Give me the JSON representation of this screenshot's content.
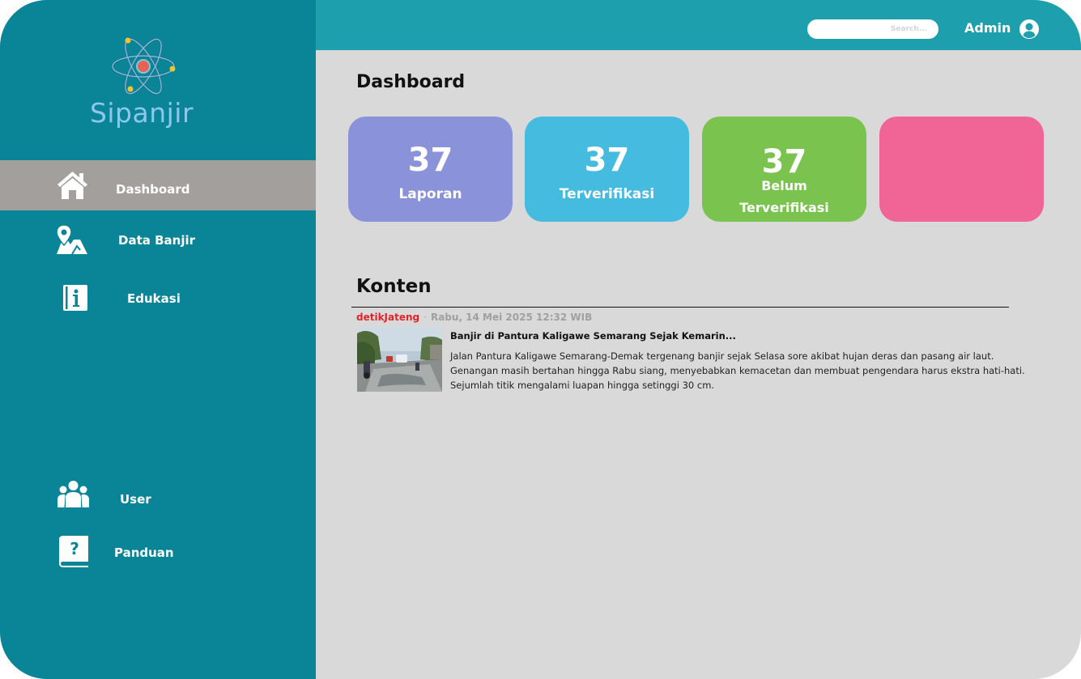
{
  "app": {
    "name": "Sipanjir"
  },
  "header": {
    "search_placeholder": "Search...",
    "user_label": "Admin",
    "user_icon": "user-circle-icon"
  },
  "sidebar": {
    "items": [
      {
        "label": "Dashboard",
        "icon": "home-icon",
        "active": true
      },
      {
        "label": "Data Banjir",
        "icon": "map-pin-icon",
        "active": false
      },
      {
        "label": "Edukasi",
        "icon": "info-book-icon",
        "active": false
      },
      {
        "label": "User",
        "icon": "users-icon",
        "active": false
      },
      {
        "label": "Panduan",
        "icon": "help-book-icon",
        "active": false
      }
    ]
  },
  "dashboard": {
    "title": "Dashboard",
    "cards": [
      {
        "value": "37",
        "label": "Laporan",
        "color": "#8a92d9"
      },
      {
        "value": "37",
        "label": "Terverifikasi",
        "color": "#46bbe0"
      },
      {
        "value": "37",
        "label_line1": "Belum",
        "label_line2": "Terverifikasi",
        "color": "#7ac34e"
      },
      {
        "value": "",
        "label": "",
        "color": "#f06595"
      }
    ]
  },
  "content": {
    "title": "Konten",
    "news": {
      "source": "detikJateng",
      "separator": "·",
      "date": "Rabu, 14 Mei 2025 12:32 WIB",
      "headline": "Banjir di Pantura Kaligawe Semarang Sejak Kemarin...",
      "body_lines": [
        "Jalan Pantura Kaligawe Semarang-Demak tergenang banjir sejak Selasa sore akibat hujan deras dan pasang air laut.",
        "Genangan masih bertahan hingga Rabu siang, menyebabkan kemacetan dan membuat pengendara harus ekstra hati-hati.",
        "Sejumlah titik mengalami luapan hingga setinggi 30 cm."
      ]
    }
  },
  "colors": {
    "sidebar": "#098597",
    "topbar": "#1e9fad",
    "background": "#d9d9d9",
    "active_nav": "#a39f9d",
    "source_red": "#e3242b"
  }
}
